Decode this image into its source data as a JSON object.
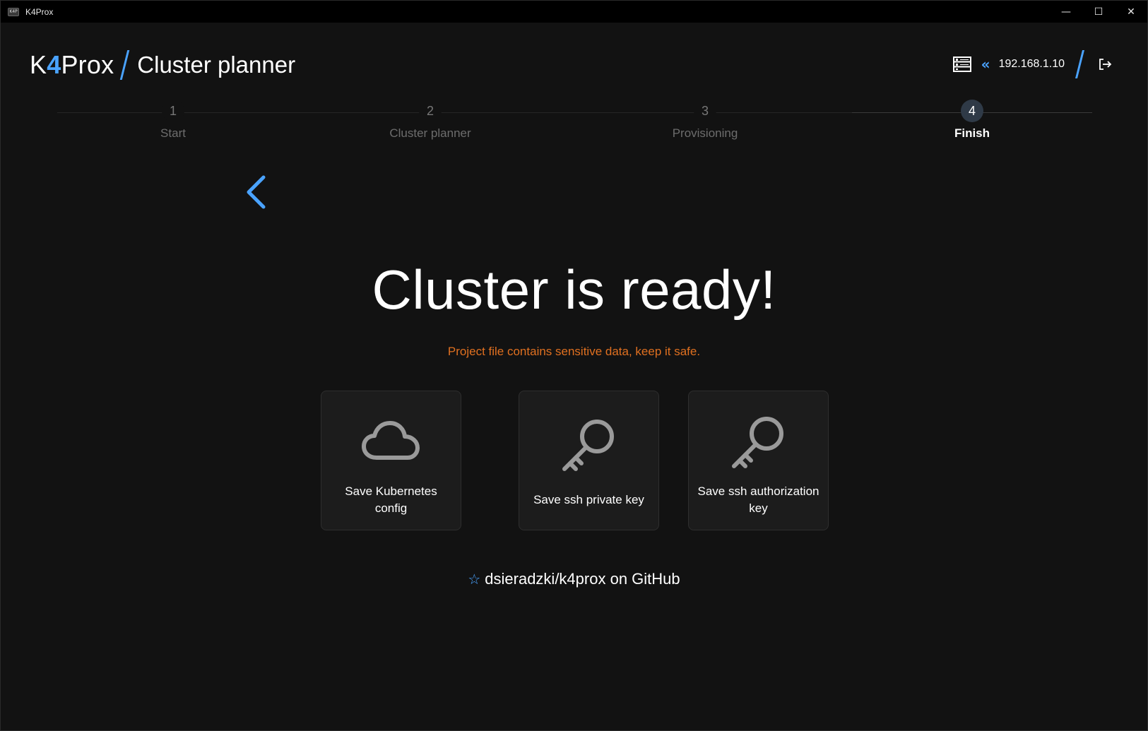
{
  "window": {
    "title": "K4Prox",
    "icon_text": "K4P",
    "controls": {
      "minimize": "—",
      "maximize": "☐",
      "close": "✕"
    }
  },
  "header": {
    "brand_prefix": "K",
    "brand_accent": "4",
    "brand_suffix": "Prox",
    "section": "Cluster planner",
    "host_ip": "192.168.1.10",
    "icons": [
      "server-icon",
      "chevron-double-left-icon",
      "logout-icon"
    ]
  },
  "stepper": {
    "steps": [
      {
        "num": "1",
        "label": "Start",
        "active": false
      },
      {
        "num": "2",
        "label": "Cluster planner",
        "active": false
      },
      {
        "num": "3",
        "label": "Provisioning",
        "active": false
      },
      {
        "num": "4",
        "label": "Finish",
        "active": true
      }
    ]
  },
  "main": {
    "headline": "Cluster is ready!",
    "warning": "Project file contains sensitive data, keep it safe.",
    "cards": [
      {
        "label": "Save Kubernetes config",
        "icon": "cloud-icon"
      },
      {
        "label": "Save ssh private key",
        "icon": "key-icon"
      },
      {
        "label": "Save ssh authorization key",
        "icon": "key-icon"
      }
    ],
    "github_link": "dsieradzki/k4prox on GitHub",
    "github_icon": "star-icon"
  },
  "colors": {
    "background": "#121212",
    "accent": "#4aa3ff",
    "warning": "#e07020",
    "card_bg": "#1c1c1c"
  }
}
